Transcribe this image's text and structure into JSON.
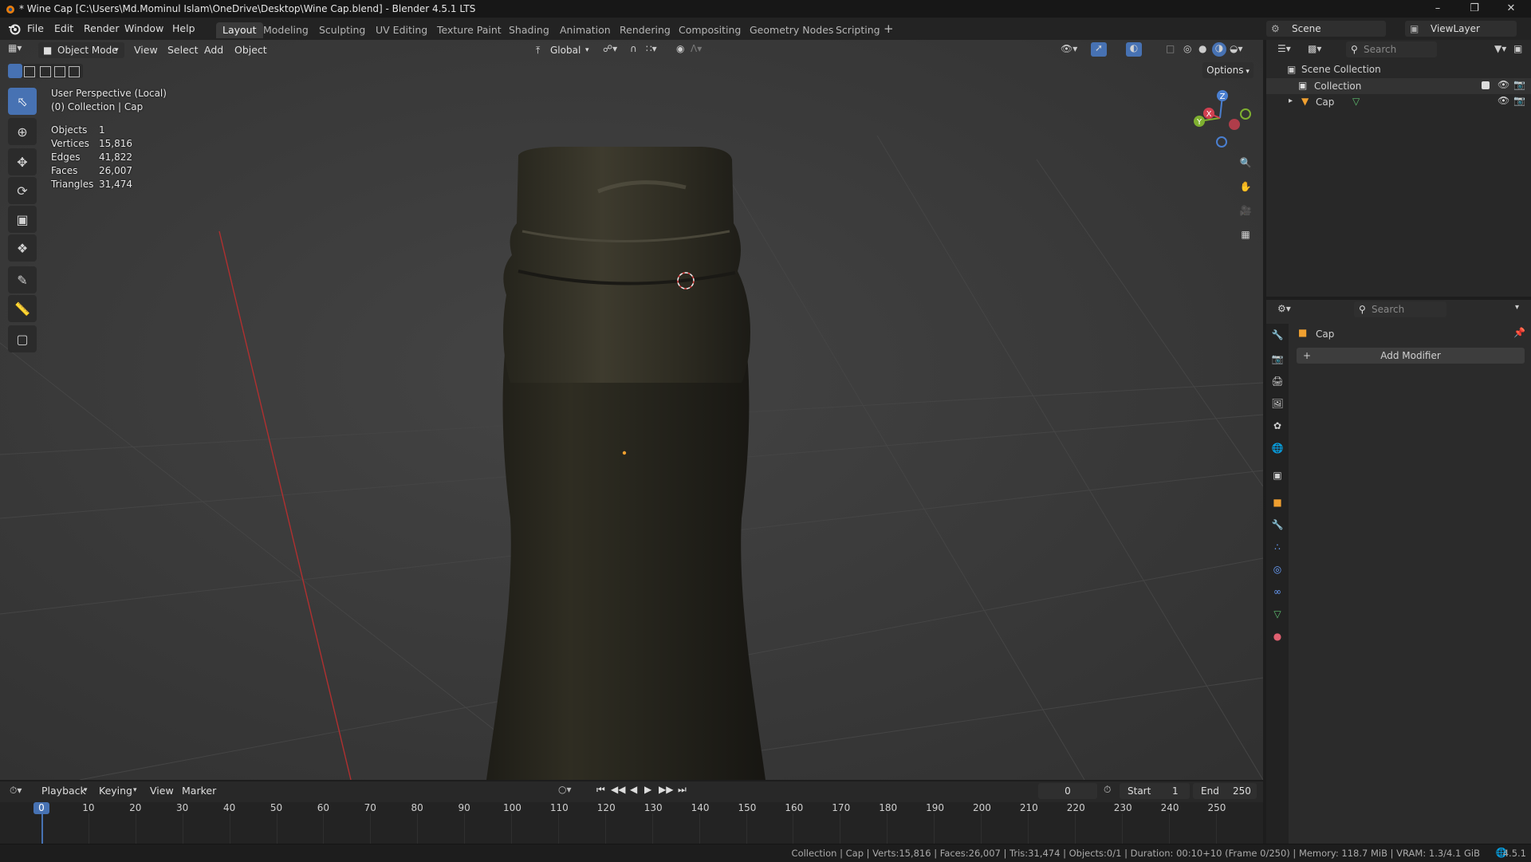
{
  "window": {
    "title": "* Wine Cap [C:\\Users\\Md.Mominul Islam\\OneDrive\\Desktop\\Wine Cap.blend] - Blender 4.5.1 LTS"
  },
  "menu": [
    "File",
    "Edit",
    "Render",
    "Window",
    "Help"
  ],
  "workspaces": [
    {
      "label": "Layout",
      "active": true
    },
    {
      "label": "Modeling"
    },
    {
      "label": "Sculpting"
    },
    {
      "label": "UV Editing"
    },
    {
      "label": "Texture Paint"
    },
    {
      "label": "Shading"
    },
    {
      "label": "Animation"
    },
    {
      "label": "Rendering"
    },
    {
      "label": "Compositing"
    },
    {
      "label": "Geometry Nodes"
    },
    {
      "label": "Scripting"
    }
  ],
  "scene": {
    "label": "Scene",
    "view_layer": "ViewLayer"
  },
  "viewport_header": {
    "mode": "Object Mode",
    "menus": [
      "View",
      "Select",
      "Add",
      "Object"
    ],
    "orientation": "Global",
    "options": "Options"
  },
  "viewport_info": {
    "line1": "User Perspective (Local)",
    "line2": "(0) Collection | Cap",
    "stats": [
      {
        "label": "Objects",
        "value": "1"
      },
      {
        "label": "Vertices",
        "value": "15,816"
      },
      {
        "label": "Edges",
        "value": "41,822"
      },
      {
        "label": "Faces",
        "value": "26,007"
      },
      {
        "label": "Triangles",
        "value": "31,474"
      }
    ]
  },
  "gizmo": {
    "z": "Z",
    "y": "Y",
    "x": "X"
  },
  "outliner": {
    "search_placeholder": "Search",
    "root": "Scene Collection",
    "items": [
      {
        "label": "Collection"
      },
      {
        "label": "Cap"
      }
    ]
  },
  "properties": {
    "search_placeholder": "Search",
    "object_name": "Cap",
    "add_modifier": "Add Modifier"
  },
  "timeline": {
    "menus": [
      "Playback",
      "Keying",
      "View",
      "Marker"
    ],
    "current_frame": "0",
    "start_label": "Start",
    "start": "1",
    "end_label": "End",
    "end": "250",
    "ticks": [
      "0",
      "10",
      "20",
      "30",
      "40",
      "50",
      "60",
      "70",
      "80",
      "90",
      "100",
      "110",
      "120",
      "130",
      "140",
      "150",
      "160",
      "170",
      "180",
      "190",
      "200",
      "210",
      "220",
      "230",
      "240",
      "250"
    ]
  },
  "status": {
    "text": "Collection | Cap | Verts:15,816 | Faces:26,007 | Tris:31,474 | Objects:0/1 | Duration: 00:10+10 (Frame 0/250) | Memory: 118.7 MiB | VRAM: 1.3/4.1 GiB",
    "version": "4.5.1"
  },
  "colors": {
    "accent": "#4772b3",
    "viewport_bg": "#393939",
    "frame_marker": "#4772b3"
  }
}
